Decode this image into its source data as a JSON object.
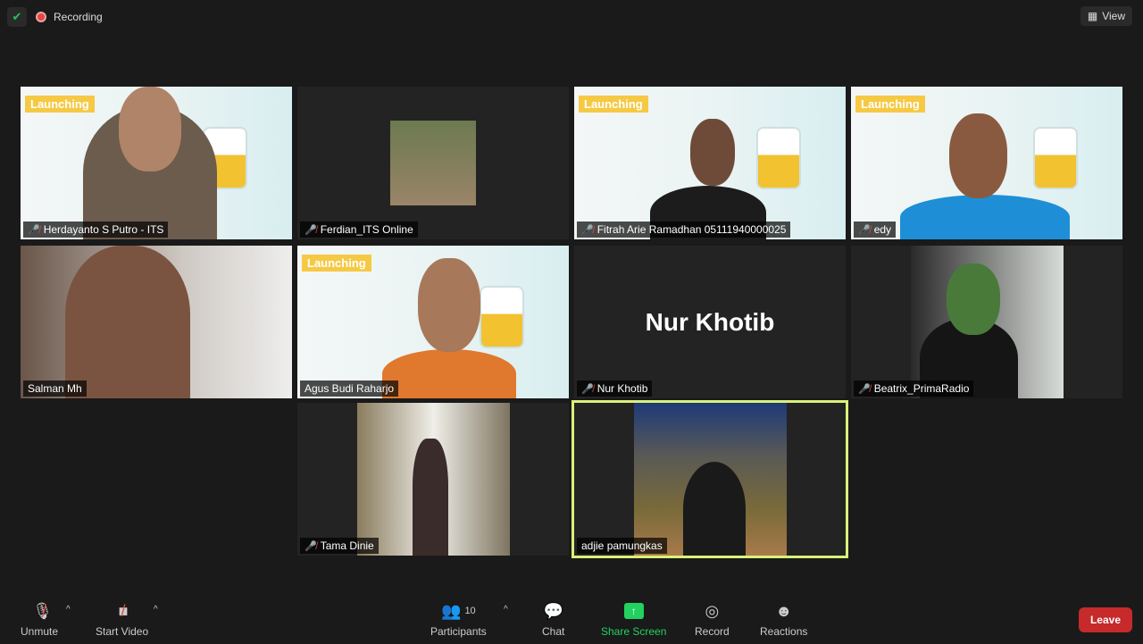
{
  "top": {
    "recording_label": "Recording",
    "view_label": "View"
  },
  "participants": [
    {
      "name": "Herdayanto S Putro - ITS",
      "muted": true,
      "bg": "launch",
      "tag": "Launching"
    },
    {
      "name": "Ferdian_ITS Online",
      "muted": true
    },
    {
      "name": "Fitrah Arie Ramadhan 05111940000025",
      "muted": true,
      "bg": "launch",
      "tag": "Launching"
    },
    {
      "name": "edy",
      "muted": true,
      "bg": "launch",
      "tag": "Launching"
    },
    {
      "name": "Salman Mh",
      "muted": false
    },
    {
      "name": "Agus Budi Raharjo",
      "muted": false,
      "bg": "launch",
      "tag": "Launching"
    },
    {
      "name": "Nur Khotib",
      "muted": true,
      "display_name": "Nur Khotib"
    },
    {
      "name": "Beatrix_PrimaRadio",
      "muted": true
    },
    {
      "name": "Tama Dinie",
      "muted": true
    },
    {
      "name": "adjie pamungkas",
      "muted": false,
      "active_speaker": true
    }
  ],
  "toolbar": {
    "unmute": "Unmute",
    "start_video": "Start Video",
    "participants": "Participants",
    "participant_count": "10",
    "chat": "Chat",
    "share_screen": "Share Screen",
    "record": "Record",
    "reactions": "Reactions",
    "leave": "Leave"
  },
  "colors": {
    "active_speaker": "#d9f17a",
    "share": "#23d160",
    "leave": "#c62a2a",
    "mute": "#e04848"
  }
}
